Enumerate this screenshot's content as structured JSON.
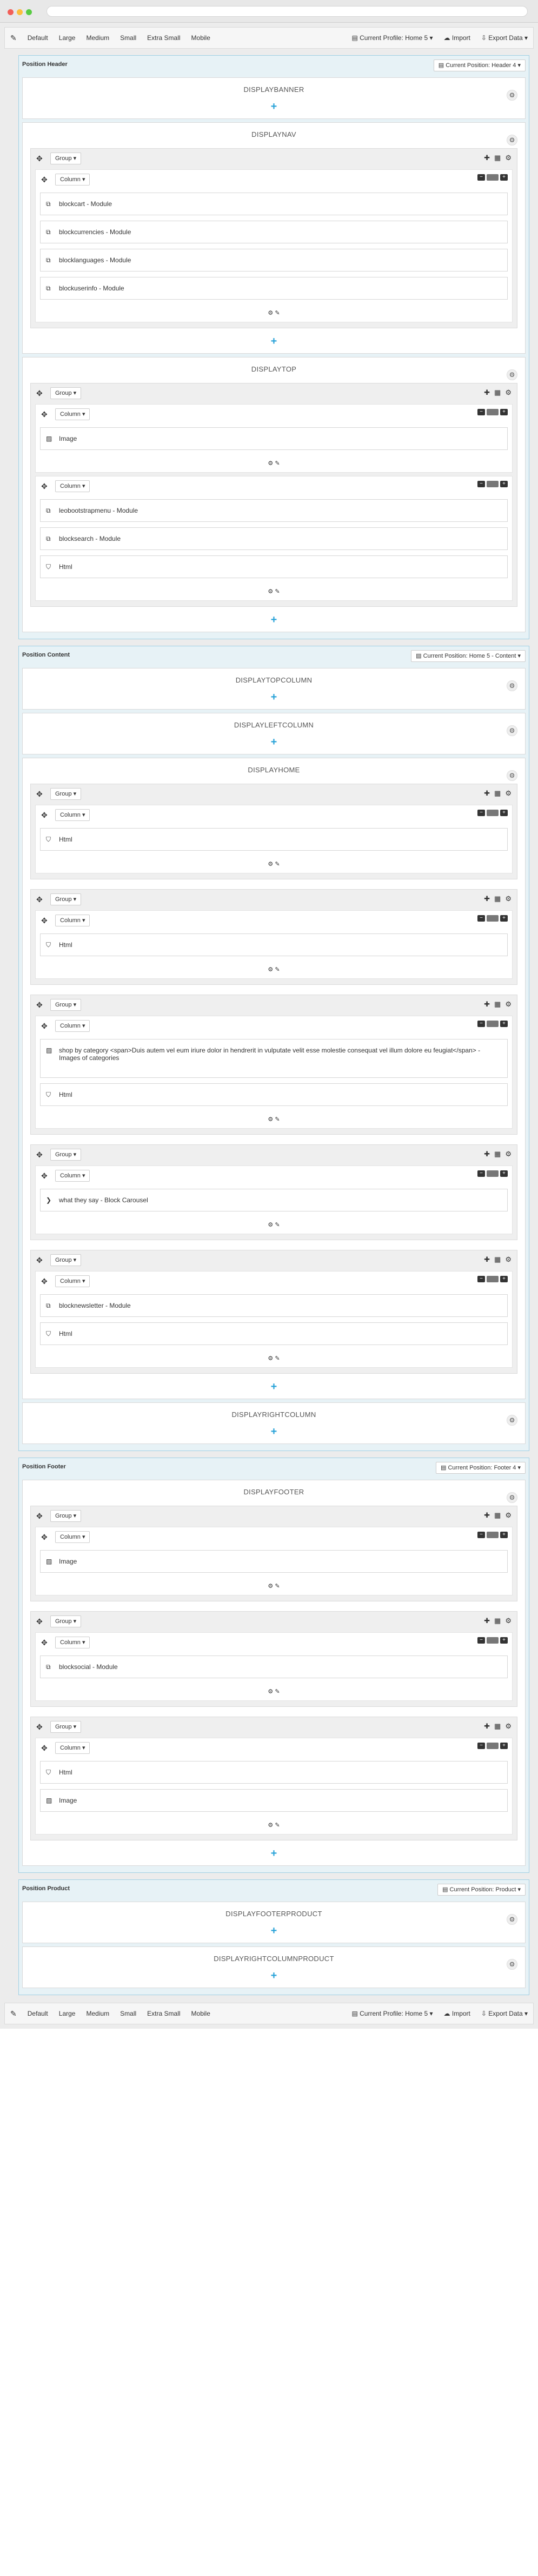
{
  "toolbar": {
    "devices": [
      "Default",
      "Large",
      "Medium",
      "Small",
      "Extra Small",
      "Mobile"
    ],
    "profile": "Current Profile: Home 5",
    "import": "Import",
    "export": "Export Data"
  },
  "positions": [
    {
      "title": "Position Header",
      "select": "Current Position: Header 4",
      "hooks": [
        {
          "title": "DISPLAYBANNER",
          "groups": []
        },
        {
          "title": "DISPLAYNAV",
          "groups": [
            {
              "label": "Group",
              "columns": [
                {
                  "label": "Column",
                  "modules": [
                    {
                      "icon": "module",
                      "text": "blockcart - Module"
                    },
                    {
                      "icon": "module",
                      "text": "blockcurrencies - Module"
                    },
                    {
                      "icon": "module",
                      "text": "blocklanguages - Module"
                    },
                    {
                      "icon": "module",
                      "text": "blockuserinfo - Module"
                    }
                  ]
                }
              ]
            }
          ]
        },
        {
          "title": "DISPLAYTOP",
          "groups": [
            {
              "label": "Group",
              "columns": [
                {
                  "label": "Column",
                  "modules": [
                    {
                      "icon": "image",
                      "text": "Image"
                    }
                  ]
                },
                {
                  "label": "Column",
                  "modules": [
                    {
                      "icon": "module",
                      "text": "leobootstrapmenu - Module"
                    },
                    {
                      "icon": "module",
                      "text": "blocksearch - Module"
                    },
                    {
                      "icon": "html",
                      "text": "Html"
                    }
                  ]
                }
              ]
            }
          ]
        }
      ]
    },
    {
      "title": "Position Content",
      "select": "Current Position: Home 5 - Content",
      "hooks": [
        {
          "title": "DISPLAYTOPCOLUMN",
          "groups": []
        },
        {
          "title": "DISPLAYLEFTCOLUMN",
          "groups": []
        },
        {
          "title": "DISPLAYHOME",
          "groups": [
            {
              "label": "Group",
              "columns": [
                {
                  "label": "Column",
                  "modules": [
                    {
                      "icon": "html",
                      "text": "Html"
                    }
                  ]
                }
              ]
            },
            {
              "label": "Group",
              "columns": [
                {
                  "label": "Column",
                  "modules": [
                    {
                      "icon": "html",
                      "text": "Html"
                    }
                  ]
                }
              ]
            },
            {
              "label": "Group",
              "columns": [
                {
                  "label": "Column",
                  "modules": [
                    {
                      "icon": "image",
                      "text": "shop by category <span>Duis autem vel eum iriure dolor in hendrerit in vulputate velit esse molestie consequat vel illum dolore eu feugiat</span> - Images of categories",
                      "tall": true
                    },
                    {
                      "icon": "html",
                      "text": "Html"
                    }
                  ]
                }
              ]
            },
            {
              "label": "Group",
              "columns": [
                {
                  "label": "Column",
                  "modules": [
                    {
                      "icon": "carousel",
                      "text": "what they say - Block Carousel"
                    }
                  ]
                }
              ]
            },
            {
              "label": "Group",
              "columns": [
                {
                  "label": "Column",
                  "modules": [
                    {
                      "icon": "module",
                      "text": "blocknewsletter - Module"
                    },
                    {
                      "icon": "html",
                      "text": "Html"
                    }
                  ]
                }
              ]
            }
          ]
        },
        {
          "title": "DISPLAYRIGHTCOLUMN",
          "groups": []
        }
      ]
    },
    {
      "title": "Position Footer",
      "select": "Current Position: Footer 4",
      "hooks": [
        {
          "title": "DISPLAYFOOTER",
          "groups": [
            {
              "label": "Group",
              "columns": [
                {
                  "label": "Column",
                  "modules": [
                    {
                      "icon": "image",
                      "text": "Image"
                    }
                  ]
                }
              ]
            },
            {
              "label": "Group",
              "columns": [
                {
                  "label": "Column",
                  "modules": [
                    {
                      "icon": "module",
                      "text": "blocksocial - Module"
                    }
                  ]
                }
              ]
            },
            {
              "label": "Group",
              "columns": [
                {
                  "label": "Column",
                  "modules": [
                    {
                      "icon": "html",
                      "text": "Html"
                    },
                    {
                      "icon": "image",
                      "text": "Image"
                    }
                  ]
                }
              ]
            }
          ]
        }
      ]
    },
    {
      "title": "Position Product",
      "select": "Current Position: Product",
      "hooks": [
        {
          "title": "DISPLAYFOOTERPRODUCT",
          "groups": []
        },
        {
          "title": "DISPLAYRIGHTCOLUMNPRODUCT",
          "groups": []
        }
      ]
    }
  ]
}
